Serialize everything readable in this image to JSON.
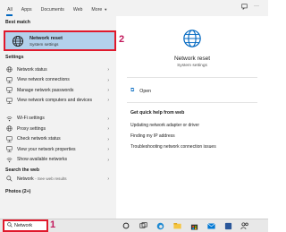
{
  "tabs": [
    {
      "label": "All",
      "active": true
    },
    {
      "label": "Apps"
    },
    {
      "label": "Documents"
    },
    {
      "label": "Web"
    },
    {
      "label": "More"
    }
  ],
  "left": {
    "best_match_header": "Best match",
    "best_match": {
      "title": "Network reset",
      "subtitle": "System settings",
      "icon": "globe-icon"
    },
    "settings_header": "Settings",
    "settings": [
      {
        "label": "Network status",
        "icon": "globe-icon"
      },
      {
        "label": "View network connections",
        "icon": "network-icon"
      },
      {
        "label": "Manage network passwords",
        "icon": "network-icon"
      },
      {
        "label": "View network computers and devices",
        "icon": "network-icon"
      },
      {
        "label": "Wi-Fi settings",
        "icon": "wifi-icon"
      },
      {
        "label": "Proxy settings",
        "icon": "globe-icon"
      },
      {
        "label": "Check network status",
        "icon": "network-icon"
      },
      {
        "label": "View your network properties",
        "icon": "network-icon"
      },
      {
        "label": "Show available networks",
        "icon": "wifi-icon"
      }
    ],
    "web_header": "Search the web",
    "web_item": {
      "label": "Network",
      "suffix": "- See web results"
    },
    "photos_header": "Photos (2+)"
  },
  "right": {
    "title": "Network reset",
    "subtitle": "System settings",
    "open_label": "Open",
    "help_header": "Get quick help from web",
    "help_links": [
      "Updating network adapter or driver",
      "Finding my IP address",
      "Troubleshooting network connection issues"
    ]
  },
  "annotations": {
    "step1": "1",
    "step2": "2"
  },
  "taskbar": {
    "search_value": "Network",
    "search_placeholder": "reset"
  },
  "colors": {
    "accent": "#0067c0",
    "highlight": "#b3d1ec",
    "annotation_border": "#e0192c",
    "annotation_number": "#c2185b"
  }
}
